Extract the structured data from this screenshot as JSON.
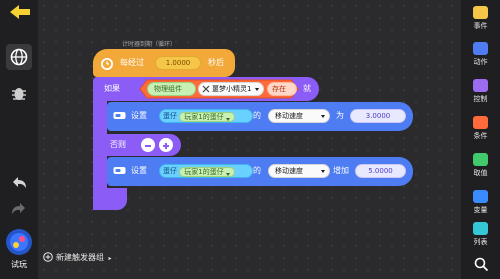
{
  "trigger_caption": "计时器到期（循环）",
  "timer_block": {
    "prefix": "每经过",
    "interval": "1.0000",
    "suffix": "秒后"
  },
  "if_block": {
    "if_label": "如果",
    "condition": {
      "component": "物理组件",
      "object": "噩梦小精灵1",
      "state": "存在"
    },
    "then_label": "就",
    "else_label": "否则"
  },
  "set_block_1": {
    "set_label": "设置",
    "category": "蛋仔",
    "target": "玩家1的蛋仔",
    "of_label": "的",
    "property": "移动速度",
    "op_label": "为",
    "value": "3.0000"
  },
  "set_block_2": {
    "set_label": "设置",
    "category": "蛋仔",
    "target": "玩家1的蛋仔",
    "of_label": "的",
    "property": "移动速度",
    "op_label": "增加",
    "value": "5.0000"
  },
  "footer": {
    "new_trigger_group": "新建触发器组"
  },
  "left_toolbar": {
    "trial_label": "试玩"
  },
  "right_toolbar": {
    "items": [
      {
        "label": "事件",
        "color": "#f6c648",
        "icon": "event-icon"
      },
      {
        "label": "动作",
        "color": "#4f7cf0",
        "icon": "action-icon"
      },
      {
        "label": "控制",
        "color": "#9b6cf2",
        "icon": "control-icon"
      },
      {
        "label": "条件",
        "color": "#ff6a3a",
        "icon": "condition-icon"
      },
      {
        "label": "取值",
        "color": "#42c96b",
        "icon": "value-icon"
      },
      {
        "label": "变量",
        "color": "#3a8bff",
        "icon": "variable-icon"
      },
      {
        "label": "列表",
        "color": "#35c7d6",
        "icon": "list-icon"
      }
    ]
  },
  "colors": {
    "event_block": "#f3a83a",
    "control_block": "#8b5cf6",
    "action_block": "#4d7cf3",
    "background": "#2b2b2d"
  }
}
